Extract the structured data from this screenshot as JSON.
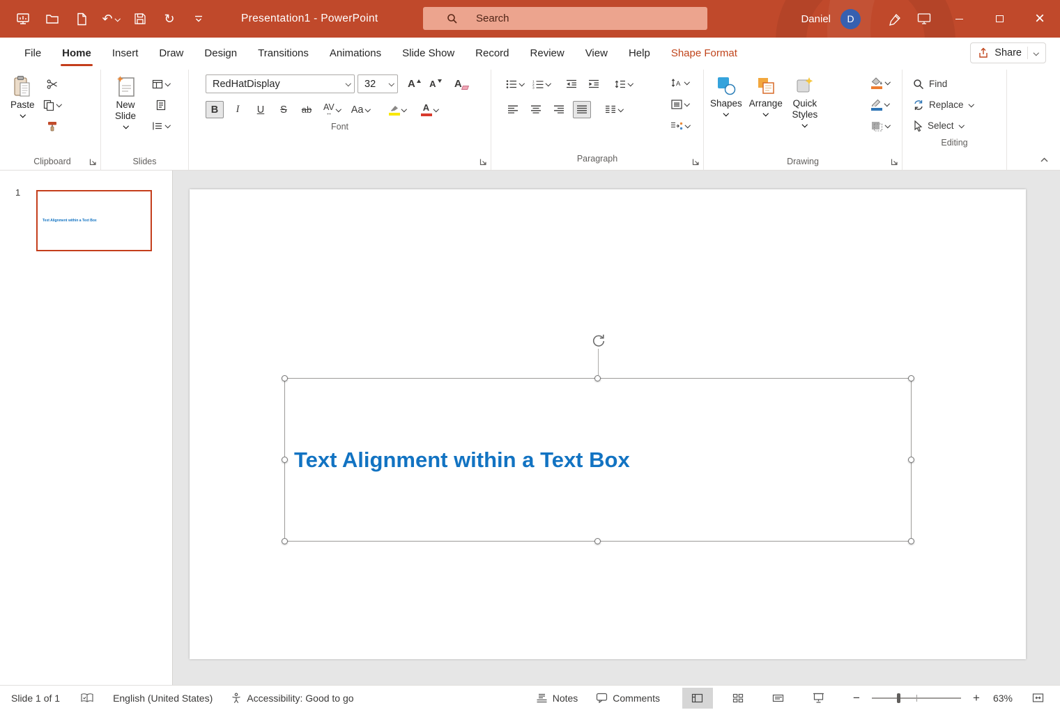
{
  "titlebar": {
    "title": "Presentation1  -  PowerPoint",
    "search_placeholder": "Search",
    "user_name": "Daniel",
    "avatar_letter": "D"
  },
  "icons": {
    "undo": "↶",
    "redo": "↻",
    "close": "×",
    "zoom_out": "−",
    "zoom_in": "+"
  },
  "tabs": {
    "file": "File",
    "home": "Home",
    "insert": "Insert",
    "draw": "Draw",
    "design": "Design",
    "transitions": "Transitions",
    "animations": "Animations",
    "slide_show": "Slide Show",
    "record": "Record",
    "review": "Review",
    "view": "View",
    "help": "Help",
    "shape_format": "Shape Format",
    "share": "Share"
  },
  "ribbon": {
    "clipboard": {
      "label": "Clipboard",
      "paste": "Paste"
    },
    "slides": {
      "label": "Slides",
      "new_slide": "New Slide"
    },
    "font": {
      "label": "Font",
      "font_name": "RedHatDisplay",
      "font_size": "32",
      "bold": "B",
      "italic": "I",
      "underline": "U",
      "strikethrough": "S",
      "strike_ab": "ab",
      "char_spacing": "AV",
      "change_case": "Aa",
      "clear_letter": "A",
      "font_color_letter": "A"
    },
    "paragraph": {
      "label": "Paragraph"
    },
    "drawing": {
      "label": "Drawing",
      "shapes": "Shapes",
      "arrange": "Arrange",
      "quick_styles": "Quick Styles"
    },
    "editing": {
      "label": "Editing",
      "find": "Find",
      "replace": "Replace",
      "select": "Select"
    }
  },
  "slides_panel": {
    "slide_number": "1",
    "thumbnail_text": "Text Alignment within a Text Box"
  },
  "slide": {
    "textbox_text": "Text Alignment within a Text Box"
  },
  "statusbar": {
    "slide_indicator": "Slide 1 of 1",
    "language": "English (United States)",
    "accessibility_status": "Accessibility: Good to go",
    "notes": "Notes",
    "comments": "Comments",
    "zoom_level": "63%"
  },
  "colors": {
    "titlebar_red": "#C0492B",
    "accent_red": "#C43E1C",
    "contextual_tab_orange": "#C0451C",
    "textbox_blue": "#1273C2",
    "avatar_blue": "#3660B0",
    "highlight_yellow": "#F9E800",
    "font_color_red": "#D83B2D"
  }
}
